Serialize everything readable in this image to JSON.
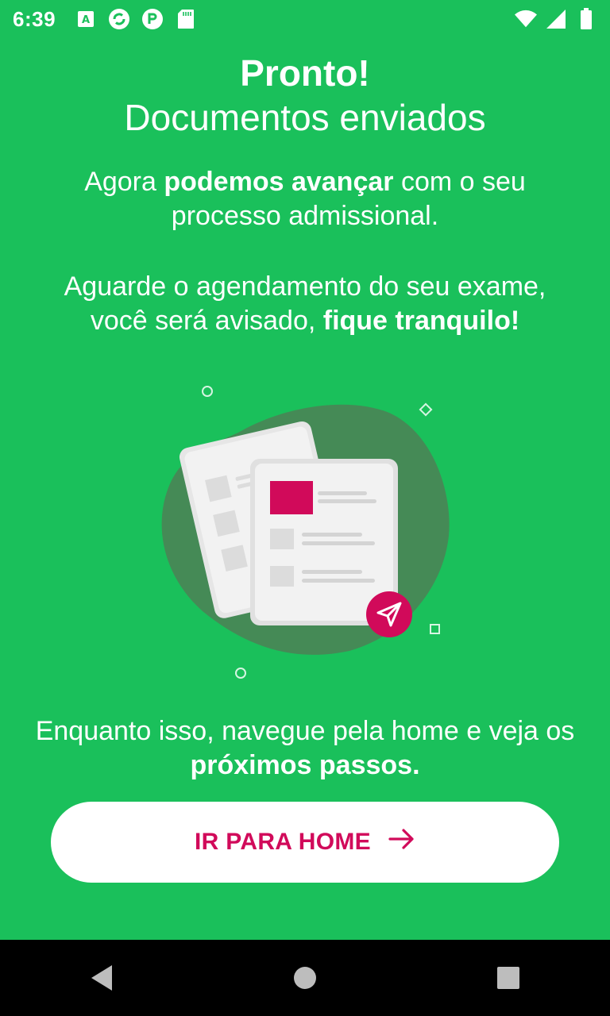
{
  "status_bar": {
    "time": "6:39",
    "left_icons": [
      "font-app-icon",
      "sync-app-icon",
      "r-app-icon",
      "sd-card-icon"
    ],
    "right_icons": [
      "wifi-icon",
      "signal-icon",
      "battery-icon"
    ]
  },
  "header": {
    "title": "Pronto!",
    "subtitle": "Documentos enviados"
  },
  "message1": {
    "part1": "Agora ",
    "bold": "podemos avançar",
    "part2": " com o seu processo admissional."
  },
  "message2": {
    "part1": "Aguarde o agendamento do seu exame, você será avisado, ",
    "bold": "fique tranquilo!"
  },
  "message3": {
    "part1": "Enquanto isso, navegue pela home e veja os ",
    "bold": "próximos passos."
  },
  "illustration": {
    "icon": "documents-sent-icon",
    "colors": {
      "blob": "#458a56",
      "accent": "#d10a5a",
      "paper": "#f2f2f2"
    }
  },
  "cta": {
    "label": "IR PARA HOME",
    "icon": "arrow-right-icon"
  },
  "nav": {
    "back": "back-icon",
    "home": "home-icon",
    "recents": "recents-icon"
  },
  "colors": {
    "background": "#1ac05b",
    "accent": "#d10a5a",
    "button_bg": "#ffffff"
  }
}
